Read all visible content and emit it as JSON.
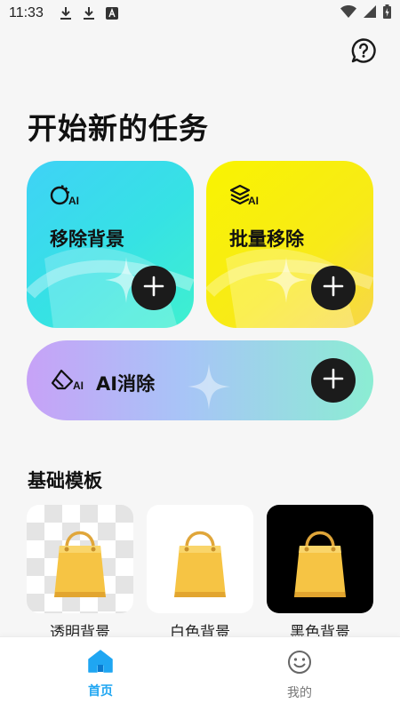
{
  "status_bar": {
    "time": "11:33"
  },
  "header": {
    "title": "开始新的任务"
  },
  "cards": {
    "remove_bg": {
      "label": "移除背景",
      "icon_tag": "AI"
    },
    "batch": {
      "label": "批量移除",
      "icon_tag": "AI"
    },
    "ai_erase": {
      "label": "AI消除",
      "icon_tag": "AI"
    }
  },
  "templates": {
    "title": "基础模板",
    "items": [
      {
        "label": "透明背景",
        "bg": "transparent-checker"
      },
      {
        "label": "白色背景",
        "bg": "#ffffff"
      },
      {
        "label": "黑色背景",
        "bg": "#000000"
      }
    ]
  },
  "bottom_nav": {
    "items": [
      {
        "label": "首页",
        "icon": "home-icon",
        "active": true
      },
      {
        "label": "我的",
        "icon": "smiley-icon",
        "active": false
      }
    ]
  },
  "colors": {
    "accent": "#1fa6f2",
    "card_remove_bg": "#3fd2f6",
    "card_batch": "#f9f400",
    "card_ai_erase": "#c7a2f7"
  }
}
